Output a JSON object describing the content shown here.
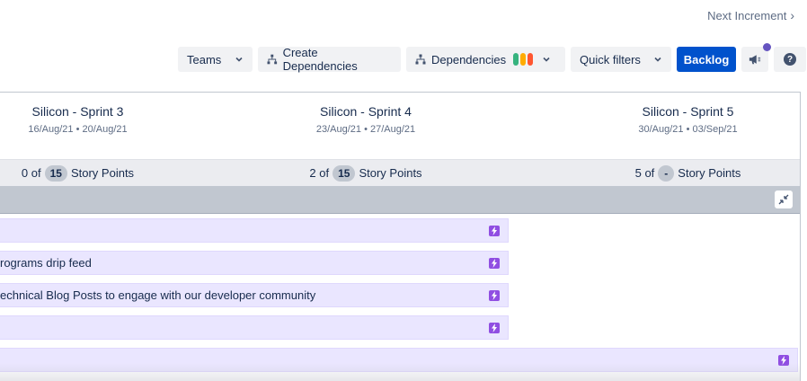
{
  "nav": {
    "next_increment": "Next Increment"
  },
  "toolbar": {
    "teams": "Teams",
    "create_dependencies": "Create Dependencies",
    "dependencies": "Dependencies",
    "dependency_colors": [
      "#36b37e",
      "#ffab00",
      "#ff5630"
    ],
    "quick_filters": "Quick filters",
    "backlog": "Backlog"
  },
  "sprints": [
    {
      "name": "Silicon - Sprint 3",
      "dates": "16/Aug/21 • 20/Aug/21",
      "points_prefix": "0 of",
      "points_badge": "15",
      "points_suffix": "Story Points"
    },
    {
      "name": "Silicon - Sprint 4",
      "dates": "23/Aug/21 • 27/Aug/21",
      "points_prefix": "2 of",
      "points_badge": "15",
      "points_suffix": "Story Points"
    },
    {
      "name": "Silicon - Sprint 5",
      "dates": "30/Aug/21 • 03/Sep/21",
      "points_prefix": "5 of",
      "points_badge": "-",
      "points_suffix": "Story Points"
    }
  ],
  "issues": [
    {
      "title": ""
    },
    {
      "title": "rograms drip feed"
    },
    {
      "title": "echnical Blog Posts to engage with our developer community"
    },
    {
      "title": ""
    },
    {
      "title": ""
    }
  ],
  "colors": {
    "primary": "#0052cc",
    "epic": "#904ee2",
    "notification": "#6554c0"
  }
}
